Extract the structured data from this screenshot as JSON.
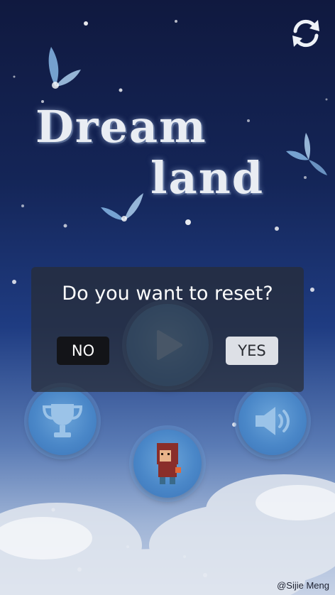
{
  "app": {
    "title_line1": "Dream",
    "title_line2": "land",
    "credit": "@Sijie Meng"
  },
  "dialog": {
    "message": "Do you want to reset?",
    "no_label": "NO",
    "yes_label": "YES"
  },
  "icons": {
    "top_right": "refresh-icon",
    "center": "play-icon",
    "left": "trophy-icon",
    "right": "speaker-icon",
    "bottom": "character-icon"
  },
  "colors": {
    "sky_top": "#10193f",
    "button_blue": "#4a87c8",
    "dialog_bg": "#282c34",
    "no_button": "#131418",
    "yes_button": "#dde0e6"
  }
}
